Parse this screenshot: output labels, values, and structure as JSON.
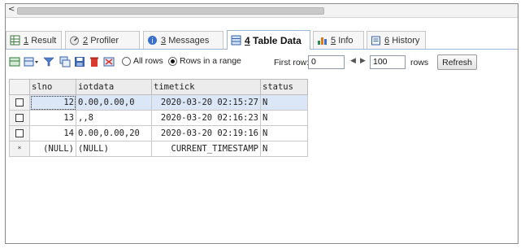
{
  "scrollbar": {
    "left_arrow": "<"
  },
  "tabs": [
    {
      "num": "1",
      "label": "Result",
      "icon": "grid-result-icon"
    },
    {
      "num": "2",
      "label": "Profiler",
      "icon": "profiler-icon"
    },
    {
      "num": "3",
      "label": "Messages",
      "icon": "messages-icon"
    },
    {
      "num": "4",
      "label": "Table Data",
      "icon": "table-data-icon",
      "active": true
    },
    {
      "num": "5",
      "label": "Info",
      "icon": "info-icon"
    },
    {
      "num": "6",
      "label": "History",
      "icon": "history-icon"
    }
  ],
  "toolbar": {
    "radio_all": "All rows",
    "radio_range": "Rows in a range",
    "first_row_label": "First row:",
    "first_row_value": "0",
    "rows_value": "100",
    "rows_label": "rows",
    "refresh_label": "Refresh",
    "prev_glyph": "◀",
    "next_glyph": "▶"
  },
  "grid": {
    "columns": [
      "slno",
      "iotdata",
      "timetick",
      "status"
    ],
    "rows": [
      {
        "slno": "12",
        "iotdata": "0.00,0.00,0",
        "timetick": "2020-03-20 02:15:27",
        "status": "N"
      },
      {
        "slno": "13",
        "iotdata": ",,8",
        "timetick": "2020-03-20 02:16:23",
        "status": "N"
      },
      {
        "slno": "14",
        "iotdata": "0.00,0.00,20",
        "timetick": "2020-03-20 02:19:16",
        "status": "N"
      }
    ],
    "new_row": {
      "marker": "*",
      "slno": "(NULL)",
      "iotdata": "(NULL)",
      "timetick": "CURRENT_TIMESTAMP",
      "status": "N"
    }
  },
  "colors": {
    "tab_border": "#9fb5d4",
    "selected_row": "#dbe6f6"
  }
}
